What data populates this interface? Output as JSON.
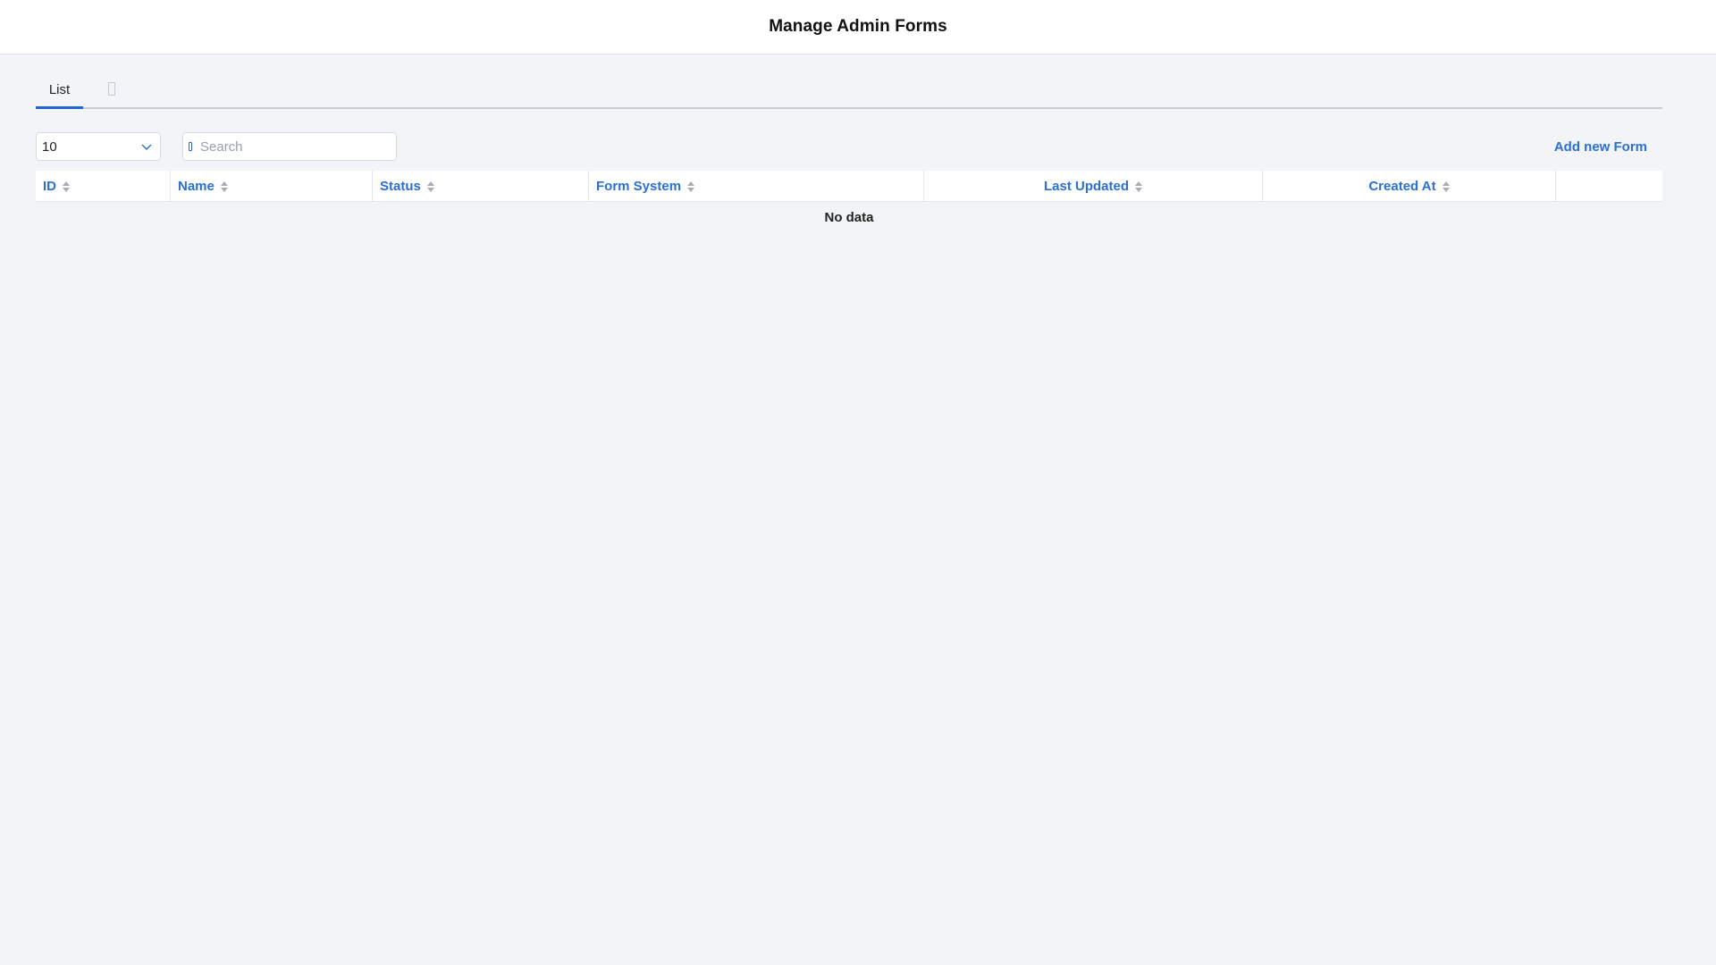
{
  "header": {
    "title": "Manage Admin Forms"
  },
  "tabs": [
    {
      "label": "List",
      "active": true
    },
    {
      "icon": "document-icon",
      "active": false
    }
  ],
  "toolbar": {
    "page_size": "10",
    "search_placeholder": "Search",
    "add_label": "Add new Form"
  },
  "table": {
    "columns": [
      "ID",
      "Name",
      "Status",
      "Form System",
      "Last Updated",
      "Created At",
      ""
    ],
    "empty_text": "No data"
  },
  "colors": {
    "accent": "#2b6fd6",
    "background": "#f3f4f7"
  }
}
